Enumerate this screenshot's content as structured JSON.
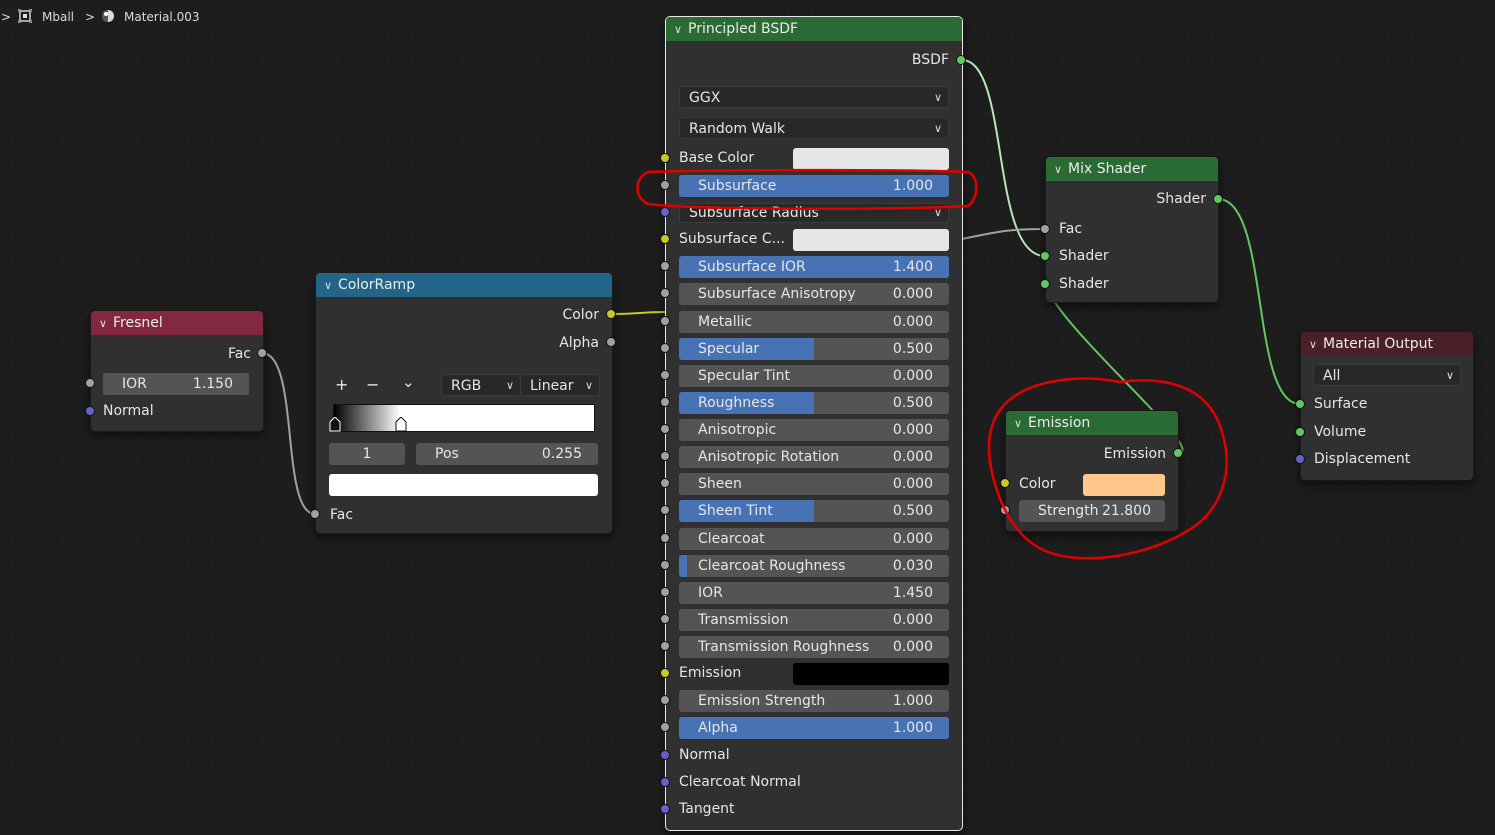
{
  "breadcrumb": {
    "object": "Mball",
    "material": "Material.003"
  },
  "icons": {
    "breadcrumb_toggle": "chevron-right-icon",
    "object": "object-square-icon",
    "separator": "chevron-right-icon",
    "material": "material-sphere-icon",
    "node_collapse": "chevron-down-icon"
  },
  "colors": {
    "shader_socket": "#63c763",
    "color_socket": "#c7c729",
    "float_socket": "#a1a1a1",
    "vector_socket": "#6363c7",
    "selection_outline": "#e00000",
    "slider_fill": "#4772b3",
    "emission_color": "#ffc78a"
  },
  "fresnel": {
    "title": "Fresnel",
    "out_fac": "Fac",
    "ior_label": "IOR",
    "ior_value": "1.150",
    "normal": "Normal"
  },
  "colorramp": {
    "title": "ColorRamp",
    "out_color": "Color",
    "out_alpha": "Alpha",
    "add": "+",
    "remove": "−",
    "menu": "⌄",
    "mode": "RGB",
    "interpolation": "Linear",
    "stop_index": "1",
    "pos_label": "Pos",
    "pos_value": "0.255",
    "in_fac": "Fac"
  },
  "principled": {
    "title": "Principled BSDF",
    "out_bsdf": "BSDF",
    "distribution": "GGX",
    "subsurface_method": "Random Walk",
    "base_color_label": "Base Color",
    "subsurface_radius": "Subsurface Radius",
    "subsurface_color_label": "Subsurface C...",
    "emission_label": "Emission",
    "normal": "Normal",
    "clearcoat_normal": "Clearcoat Normal",
    "tangent": "Tangent",
    "sliders": [
      {
        "label": "Subsurface",
        "value": "1.000",
        "fill": 1.0
      },
      {
        "label": "Subsurface IOR",
        "value": "1.400",
        "fill": 1.0
      },
      {
        "label": "Subsurface Anisotropy",
        "value": "0.000",
        "fill": 0.0
      },
      {
        "label": "Metallic",
        "value": "0.000",
        "fill": 0.0
      },
      {
        "label": "Specular",
        "value": "0.500",
        "fill": 0.5
      },
      {
        "label": "Specular Tint",
        "value": "0.000",
        "fill": 0.0
      },
      {
        "label": "Roughness",
        "value": "0.500",
        "fill": 0.5
      },
      {
        "label": "Anisotropic",
        "value": "0.000",
        "fill": 0.0
      },
      {
        "label": "Anisotropic Rotation",
        "value": "0.000",
        "fill": 0.0
      },
      {
        "label": "Sheen",
        "value": "0.000",
        "fill": 0.0
      },
      {
        "label": "Sheen Tint",
        "value": "0.500",
        "fill": 0.5
      },
      {
        "label": "Clearcoat",
        "value": "0.000",
        "fill": 0.0
      },
      {
        "label": "Clearcoat Roughness",
        "value": "0.030",
        "fill": 0.03
      },
      {
        "label": "IOR",
        "value": "1.450",
        "fill": 0.0
      },
      {
        "label": "Transmission",
        "value": "0.000",
        "fill": 0.0
      },
      {
        "label": "Transmission Roughness",
        "value": "0.000",
        "fill": 0.0
      },
      {
        "label": "Emission Strength",
        "value": "1.000",
        "fill": 0.0
      },
      {
        "label": "Alpha",
        "value": "1.000",
        "fill": 1.0
      }
    ]
  },
  "mix": {
    "title": "Mix Shader",
    "out_shader": "Shader",
    "in_fac": "Fac",
    "in_shader1": "Shader",
    "in_shader2": "Shader"
  },
  "emission": {
    "title": "Emission",
    "out_emission": "Emission",
    "color_label": "Color",
    "strength_label": "Strength",
    "strength_value": "21.800"
  },
  "output": {
    "title": "Material Output",
    "target": "All",
    "surface": "Surface",
    "volume": "Volume",
    "displacement": "Displacement"
  }
}
